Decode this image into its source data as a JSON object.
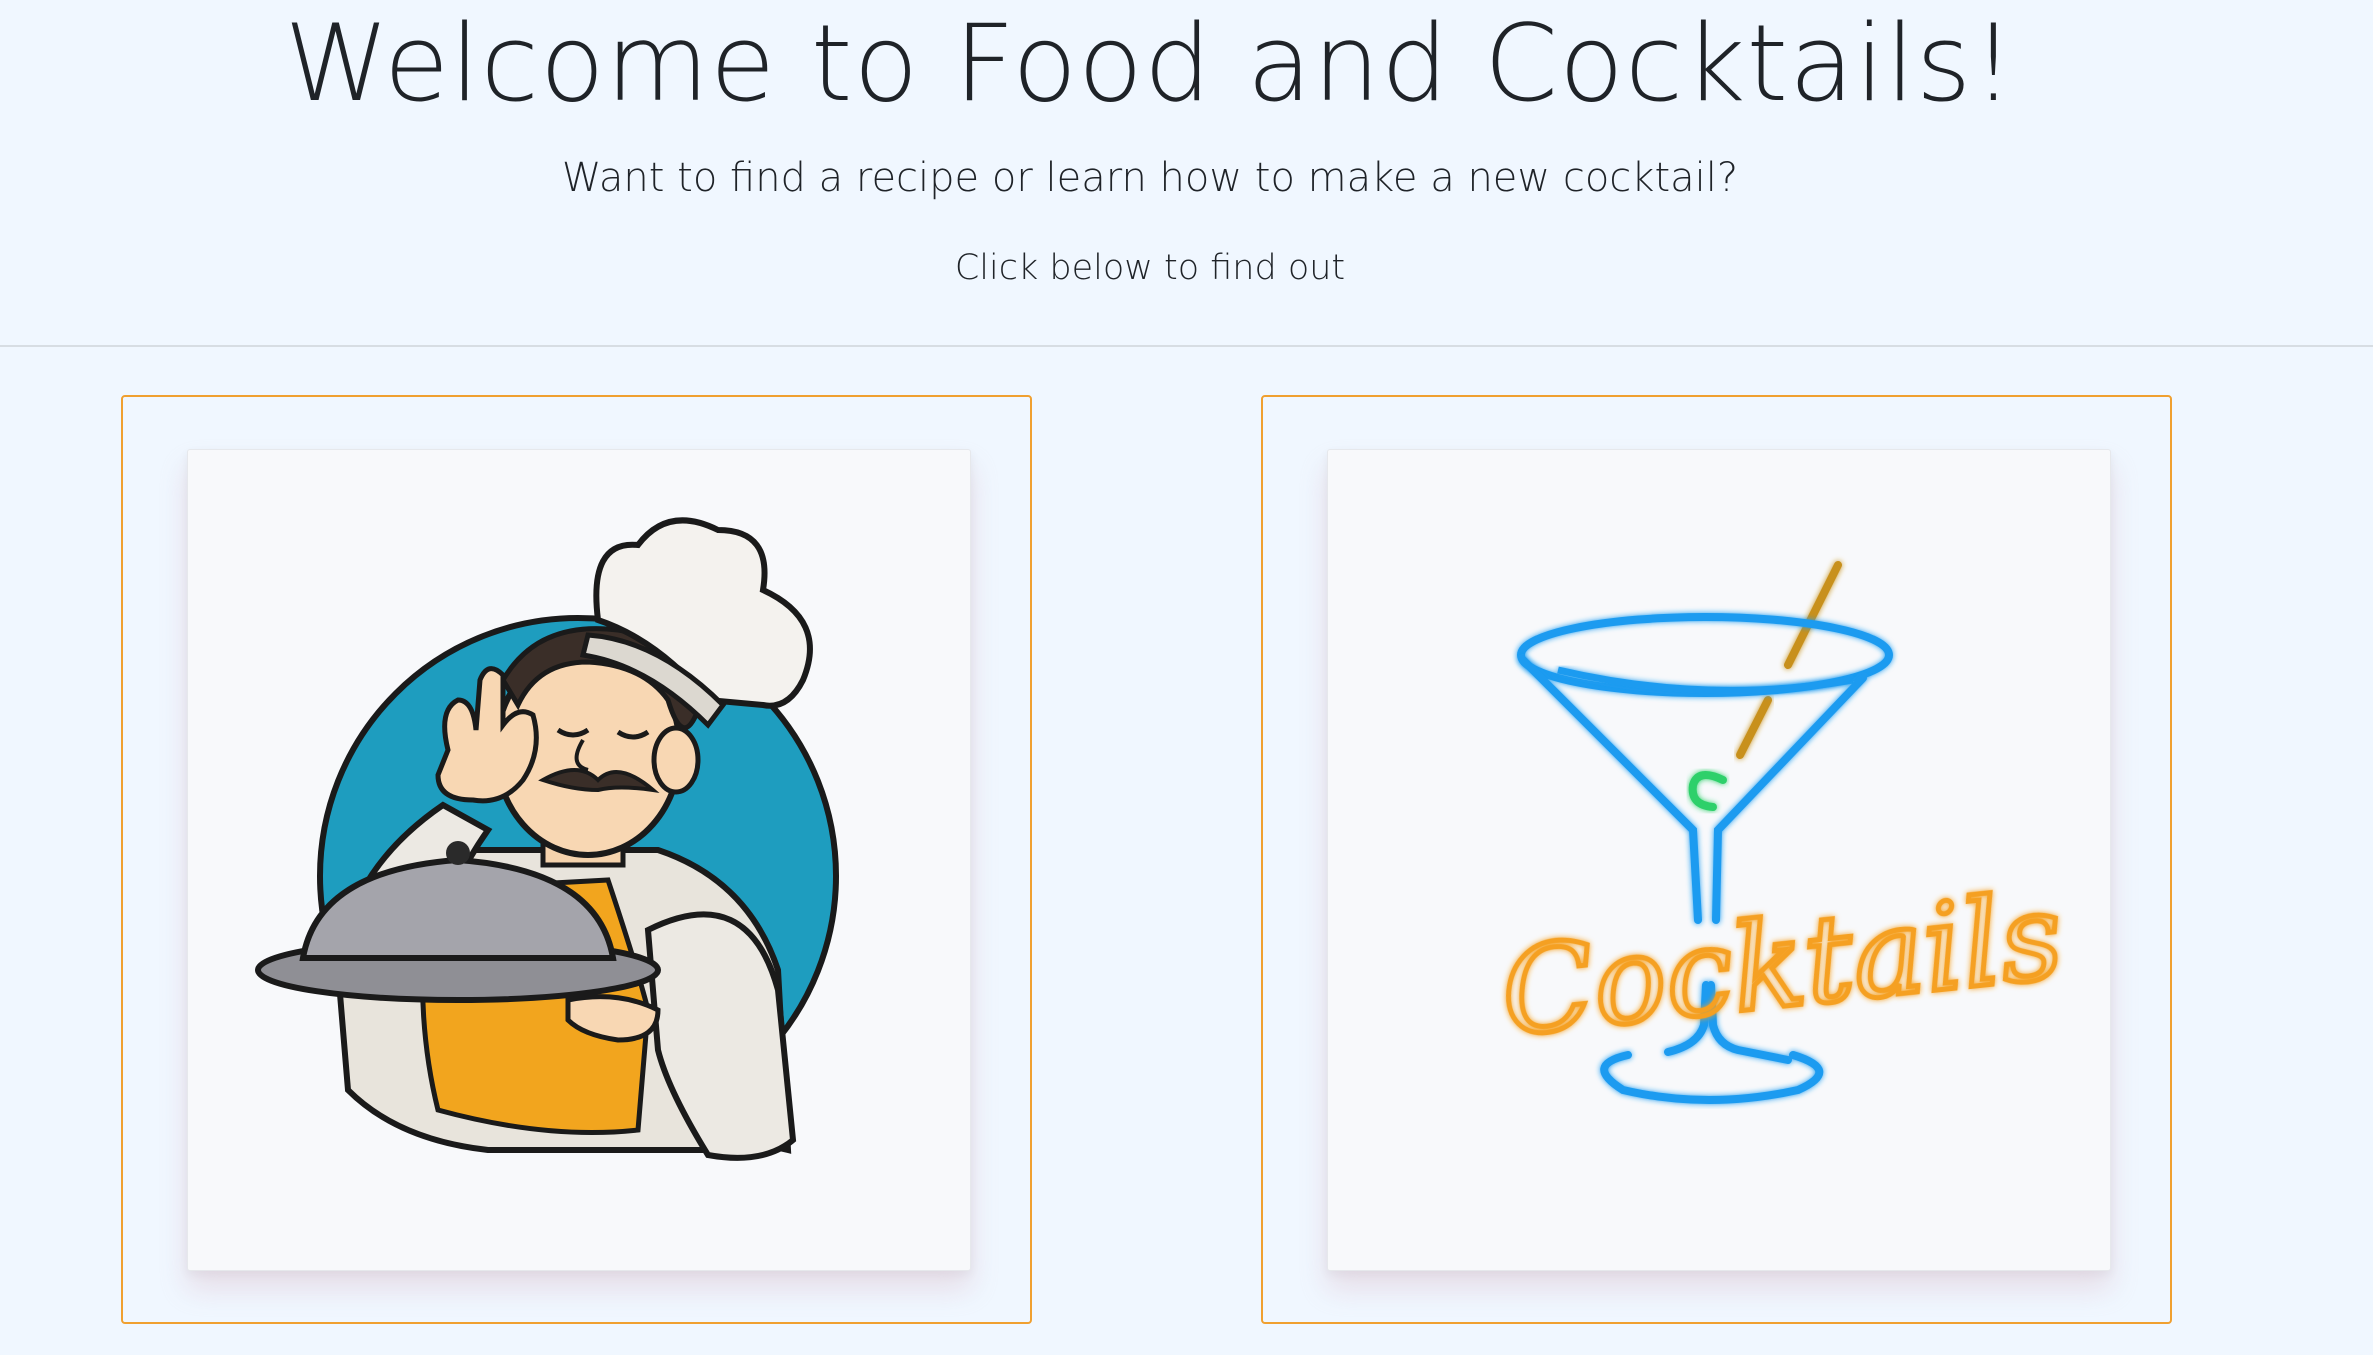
{
  "hero": {
    "title": "Welcome to Food and Cocktails!",
    "subtitle": "Want to find a recipe or learn how to make a new cocktail?",
    "cta_text": "Click below to find out"
  },
  "cards": [
    {
      "name": "food",
      "image_icon": "chef-illustration"
    },
    {
      "name": "cocktails",
      "image_icon": "neon-cocktail-sign",
      "neon_text": "Cocktails"
    }
  ],
  "colors": {
    "background": "#f0f7ff",
    "card_border": "#f0a030",
    "neon_blue": "#1e9bf0",
    "neon_orange": "#f5a020",
    "chef_circle": "#1e9dbf",
    "apron": "#f2a51e"
  }
}
